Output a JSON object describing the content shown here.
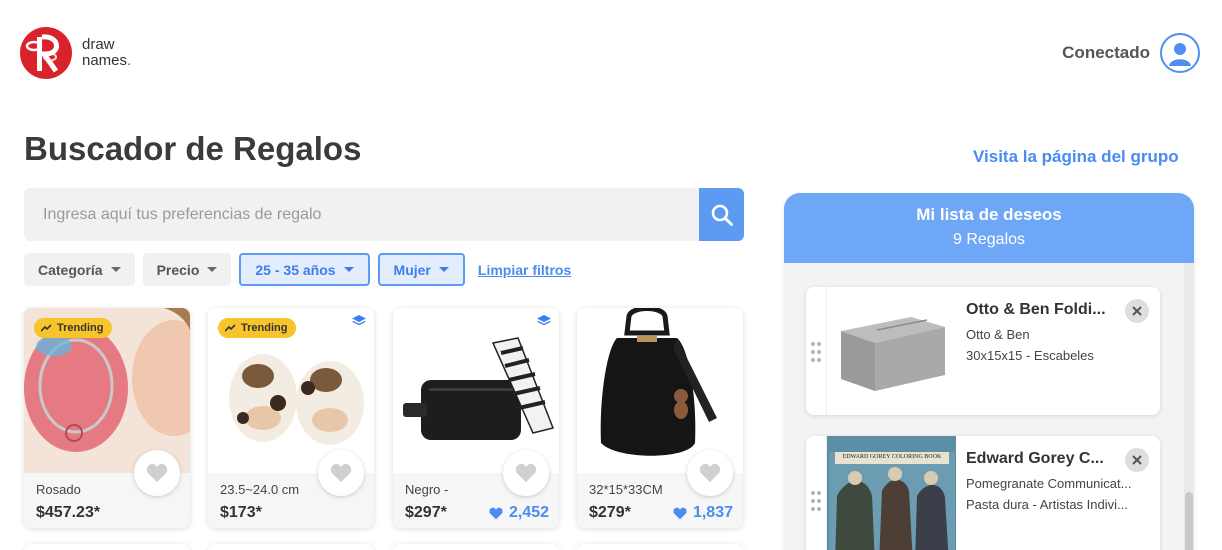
{
  "brand": {
    "line1": "draw",
    "line2": "names",
    "dot": "."
  },
  "header": {
    "user_label": "Conectado"
  },
  "page": {
    "title": "Buscador de Regalos",
    "group_link": "Visita la página del grupo"
  },
  "search": {
    "placeholder": "Ingresa aquí tus preferencias de regalo",
    "value": ""
  },
  "filters": {
    "category": "Categoría",
    "price": "Precio",
    "age": "25 - 35 años",
    "gender": "Mujer",
    "clear": "Limpiar filtros"
  },
  "products": [
    {
      "badge": "Trending",
      "variant": "Rosado",
      "price": "$457.23*",
      "likes": ""
    },
    {
      "badge": "Trending",
      "variant": "23.5~24.0 cm",
      "price": "$173*",
      "likes": ""
    },
    {
      "badge": "",
      "variant": "Negro -",
      "price": "$297*",
      "likes": "2,452"
    },
    {
      "badge": "",
      "variant": "32*15*33CM",
      "price": "$279*",
      "likes": "1,837"
    }
  ],
  "wishlist": {
    "title": "Mi lista de deseos",
    "count": "9 Regalos",
    "items": [
      {
        "title": "Otto & Ben Foldi...",
        "brand": "Otto & Ben",
        "detail": "30x15x15 - Escabeles",
        "image_text": ""
      },
      {
        "title": "Edward Gorey C...",
        "brand": "Pomegranate Communicat...",
        "detail": "Pasta dura - Artistas Indivi...",
        "image_text": "EDWARD GOREY COLORING BOOK"
      }
    ]
  },
  "colors": {
    "brand_red": "#d8232a",
    "accent_blue": "#4a8cf0",
    "trending_yellow": "#f7c52b",
    "wishlist_header": "#6ea7f5"
  },
  "icons": [
    "user-icon",
    "search-icon",
    "caret-down-icon",
    "trending-icon",
    "layers-icon",
    "heart-icon",
    "drag-handle-icon",
    "close-icon"
  ]
}
